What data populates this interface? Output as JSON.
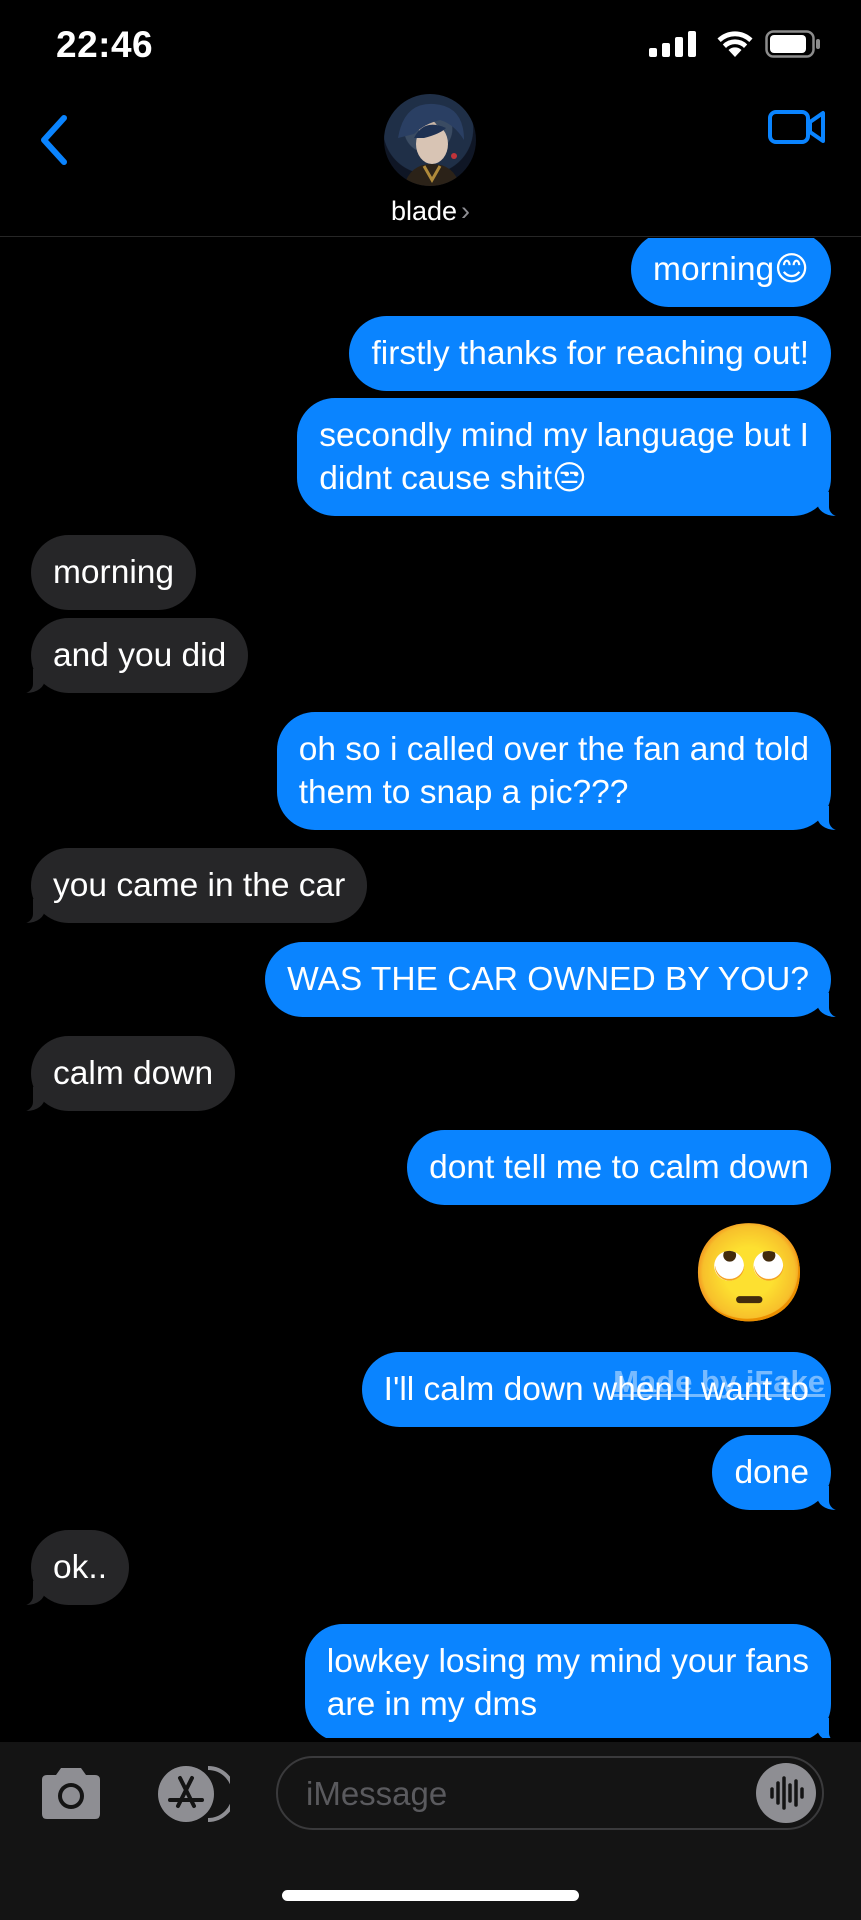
{
  "status": {
    "time": "22:46"
  },
  "header": {
    "contact_name": "blade",
    "chevron": "›"
  },
  "messages": [
    {
      "id": "m1",
      "dir": "sent",
      "text": "morning😊"
    },
    {
      "id": "m2",
      "dir": "sent",
      "text": "firstly thanks for reaching out!"
    },
    {
      "id": "m3",
      "dir": "sent",
      "text": "secondly mind my language but I\ndidnt cause shit😒"
    },
    {
      "id": "m4",
      "dir": "recv",
      "text": "morning"
    },
    {
      "id": "m5",
      "dir": "recv",
      "text": "and you did"
    },
    {
      "id": "m6",
      "dir": "sent",
      "text": "oh so i called over the fan and told\nthem to snap a pic???"
    },
    {
      "id": "m7",
      "dir": "recv",
      "text": "you came in the car"
    },
    {
      "id": "m8",
      "dir": "sent",
      "text": "WAS THE CAR OWNED BY YOU?"
    },
    {
      "id": "m9",
      "dir": "recv",
      "text": "calm down"
    },
    {
      "id": "m10",
      "dir": "sent",
      "text": "dont tell me to calm down"
    },
    {
      "id": "m11",
      "dir": "sent",
      "text": "🙄"
    },
    {
      "id": "m12",
      "dir": "sent",
      "text": "I'll calm down when I want to"
    },
    {
      "id": "m13",
      "dir": "sent",
      "text": "done"
    },
    {
      "id": "m14",
      "dir": "recv",
      "text": "ok.."
    },
    {
      "id": "m15",
      "dir": "sent",
      "text": "lowkey losing my mind your fans\nare in my dms"
    }
  ],
  "watermark": "Made by iFake",
  "composer": {
    "placeholder": "iMessage"
  },
  "colors": {
    "sent_bubble": "#0a84ff",
    "recv_bubble": "#262628",
    "accent": "#0a84ff",
    "background": "#000000"
  },
  "icons": [
    "back-chevron-icon",
    "facetime-video-icon",
    "camera-icon",
    "app-store-icon",
    "audio-waveform-icon",
    "signal-icon",
    "wifi-icon",
    "battery-icon"
  ]
}
